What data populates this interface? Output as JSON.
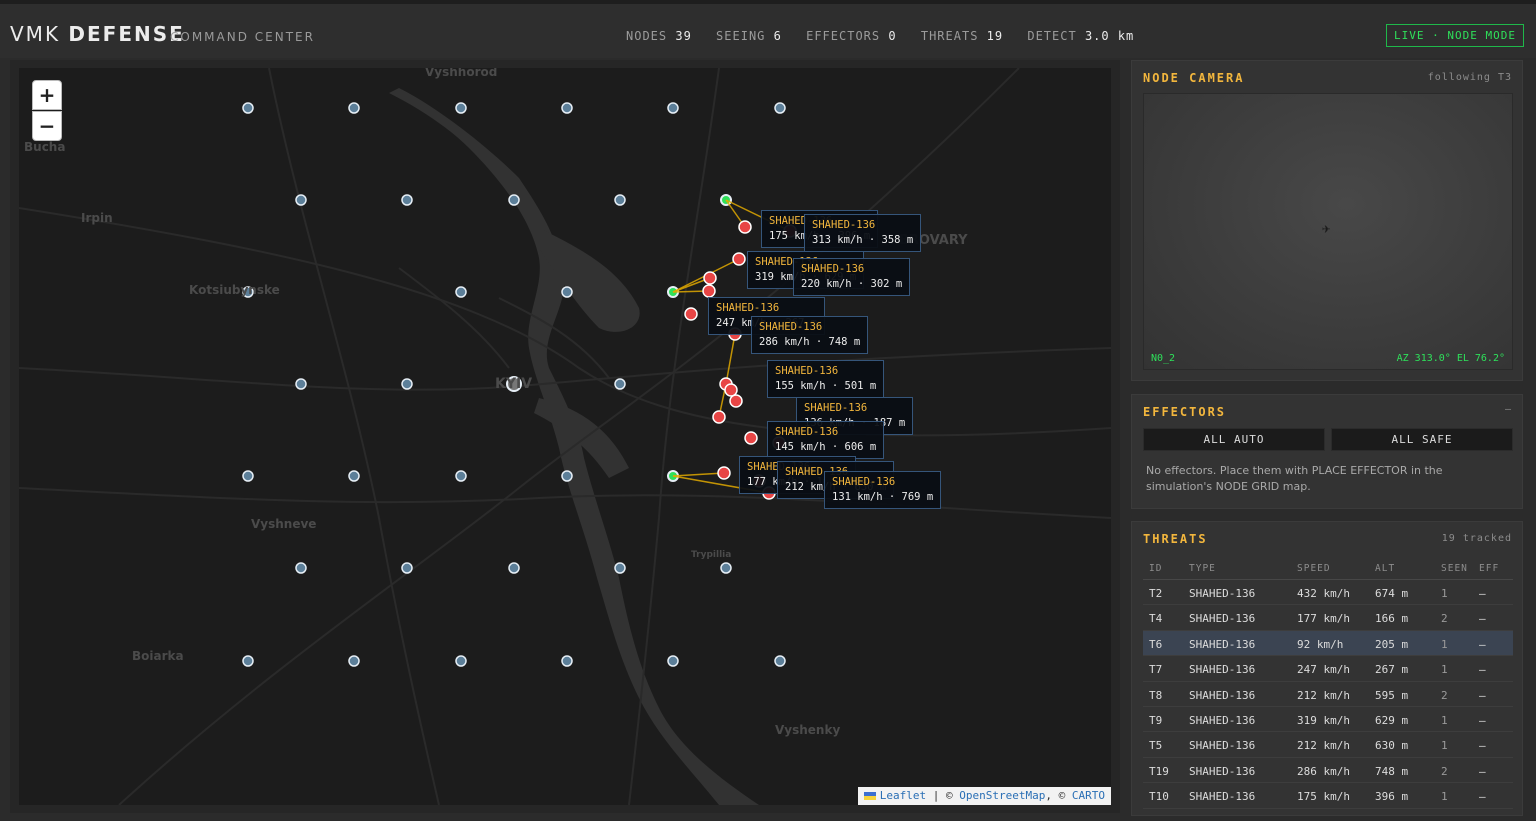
{
  "header": {
    "brand_light": "VMK",
    "brand_bold": "DEFENSE",
    "subtitle": "COMMAND CENTER",
    "stats": [
      {
        "label": "NODES",
        "value": "39"
      },
      {
        "label": "SEEING",
        "value": "6"
      },
      {
        "label": "EFFECTORS",
        "value": "0"
      },
      {
        "label": "THREATS",
        "value": "19"
      },
      {
        "label": "DETECT",
        "value": "3.0 km"
      }
    ],
    "mode": "LIVE · NODE MODE"
  },
  "map": {
    "zoom_in": "+",
    "zoom_out": "−",
    "places": [
      "Vyshhorod",
      "Bucha",
      "Irpin",
      "Kotsiubynske",
      "KYIV",
      "BROVARY",
      "Vyshneve",
      "Boiarka",
      "Vyshenky",
      "Trypillia"
    ],
    "attribution": {
      "leaflet": "Leaflet",
      "sep": " | © ",
      "osm": "OpenStreetMap",
      "sep2": ", © ",
      "carto": "CARTO"
    },
    "labels": [
      {
        "type": "SHAHED-136",
        "stats": "175 km/h · 396 m"
      },
      {
        "type": "SHAHED-136",
        "stats": "313 km/h · 358 m"
      },
      {
        "type": "SHAHED-136",
        "stats": "319 km/h · 629 m"
      },
      {
        "type": "SHAHED-136",
        "stats": "220 km/h · 302 m"
      },
      {
        "type": "SHAHED-136",
        "stats": "247 km/h · 267 m"
      },
      {
        "type": "SHAHED-136",
        "stats": "286 km/h · 748 m"
      },
      {
        "type": "SHAHED-136",
        "stats": "155 km/h · 501 m"
      },
      {
        "type": "SHAHED-136",
        "stats": "136 km/h · 187 m"
      },
      {
        "type": "SHAHED-136",
        "stats": "145 km/h · 606 m"
      },
      {
        "type": "SHAHED-136",
        "stats": "177 km/h · 166 m"
      },
      {
        "type": "SHAHED-136",
        "stats": "212 km/h · 630 m"
      },
      {
        "type": "SHAHED-136",
        "stats": "131 km/h · 769 m"
      }
    ]
  },
  "camera": {
    "title": "NODE CAMERA",
    "following": "following T3",
    "node": "N0_2",
    "az": "AZ 313.0° EL 76.2°"
  },
  "effectors": {
    "title": "EFFECTORS",
    "collapse": "—",
    "all_auto": "ALL AUTO",
    "all_safe": "ALL SAFE",
    "note": "No effectors. Place them with PLACE EFFECTOR in the simulation's NODE GRID map."
  },
  "threats": {
    "title": "THREATS",
    "tracked": "19 tracked",
    "columns": [
      "ID",
      "TYPE",
      "SPEED",
      "ALT",
      "SEEN",
      "EFF"
    ],
    "rows": [
      {
        "id": "T2",
        "type": "SHAHED-136",
        "speed": "432 km/h",
        "alt": "674 m",
        "seen": "1",
        "eff": "—"
      },
      {
        "id": "T4",
        "type": "SHAHED-136",
        "speed": "177 km/h",
        "alt": "166 m",
        "seen": "2",
        "eff": "—"
      },
      {
        "id": "T6",
        "type": "SHAHED-136",
        "speed": "92 km/h",
        "alt": "205 m",
        "seen": "1",
        "eff": "—"
      },
      {
        "id": "T7",
        "type": "SHAHED-136",
        "speed": "247 km/h",
        "alt": "267 m",
        "seen": "1",
        "eff": "—"
      },
      {
        "id": "T8",
        "type": "SHAHED-136",
        "speed": "212 km/h",
        "alt": "595 m",
        "seen": "2",
        "eff": "—"
      },
      {
        "id": "T9",
        "type": "SHAHED-136",
        "speed": "319 km/h",
        "alt": "629 m",
        "seen": "1",
        "eff": "—"
      },
      {
        "id": "T5",
        "type": "SHAHED-136",
        "speed": "212 km/h",
        "alt": "630 m",
        "seen": "1",
        "eff": "—"
      },
      {
        "id": "T19",
        "type": "SHAHED-136",
        "speed": "286 km/h",
        "alt": "748 m",
        "seen": "2",
        "eff": "—"
      },
      {
        "id": "T10",
        "type": "SHAHED-136",
        "speed": "175 km/h",
        "alt": "396 m",
        "seen": "1",
        "eff": "—"
      }
    ]
  },
  "colors": {
    "accent": "#f2b63d",
    "live": "#2ee05a",
    "threat": "#e84545",
    "node": "#5c7f99"
  }
}
